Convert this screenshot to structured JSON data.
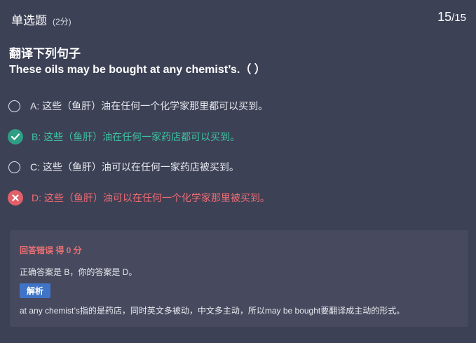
{
  "header": {
    "question_type": "单选题",
    "score": "(2分)",
    "current": "15",
    "total": "/15"
  },
  "question": {
    "title": "翻译下列句子",
    "sentence": "These oils may be bought at any chemist’s.（ ）"
  },
  "options": [
    {
      "text": "A: 这些（鱼肝）油在任何一个化学家那里都可以买到。",
      "state": "unselected"
    },
    {
      "text": "B: 这些（鱼肝）油在任何一家药店都可以买到。",
      "state": "correct"
    },
    {
      "text": "C: 这些（鱼肝）油可以在任何一家药店被买到。",
      "state": "unselected"
    },
    {
      "text": "D: 这些（鱼肝）油可以在任何一个化学家那里被买到。",
      "state": "wrong"
    }
  ],
  "result": {
    "status": "回答错误 得 0 分",
    "answer_line": "正确答案是 B，你的答案是 D。",
    "analysis_button": "解析",
    "analysis_text": "at any chemist’s指的是药店，同时英文多被动，中文多主动，所以may be bought要翻译成主动的形式。"
  },
  "colors": {
    "background": "#3d4155",
    "correct": "#3dc4a3",
    "wrong": "#ef6b74",
    "analysis_button": "#3f74c7"
  },
  "icons": {
    "correct": "check-circle-icon",
    "wrong": "cross-circle-icon",
    "unselected": "radio-empty-icon"
  }
}
